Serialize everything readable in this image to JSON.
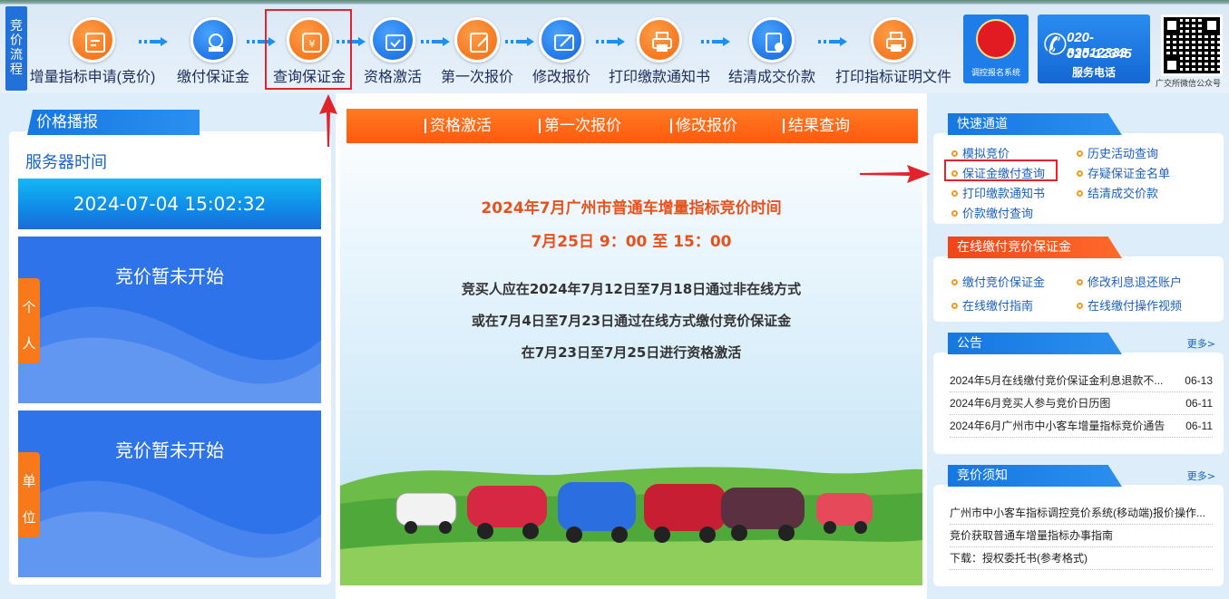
{
  "flow": {
    "label": "竞价流程",
    "steps": [
      {
        "label": "增量指标申请(竞价)",
        "icon": "application-form-icon",
        "color": "orange"
      },
      {
        "label": "缴付保证金",
        "icon": "deposit-payment-icon",
        "color": "blue"
      },
      {
        "label": "查询保证金",
        "icon": "deposit-query-icon",
        "color": "orange"
      },
      {
        "label": "资格激活",
        "icon": "activation-icon",
        "color": "blue"
      },
      {
        "label": "第一次报价",
        "icon": "first-bid-icon",
        "color": "orange"
      },
      {
        "label": "修改报价",
        "icon": "modify-bid-icon",
        "color": "blue"
      },
      {
        "label": "打印缴款通知书",
        "icon": "printer-icon",
        "color": "orange"
      },
      {
        "label": "结清成交价款",
        "icon": "settle-payment-icon",
        "color": "blue"
      },
      {
        "label": "打印指标证明文件",
        "icon": "printer-icon",
        "color": "orange"
      }
    ]
  },
  "header_right": {
    "system_caption": "调控报名系统",
    "phone1": "020-83512333",
    "phone2": "020-12345",
    "service_caption": "服务电话",
    "qr_caption": "广交所微信公众号"
  },
  "price_panel": {
    "title": "价格播报",
    "server_label": "服务器时间",
    "server_time": "2024-07-04 15:02:32",
    "personal": {
      "status": "竞价暂未开始",
      "tag_1": "个",
      "tag_2": "人"
    },
    "company": {
      "status": "竞价暂未开始",
      "tag_1": "单",
      "tag_2": "位"
    }
  },
  "banner": {
    "tabs": [
      "资格激活",
      "第一次报价",
      "修改报价",
      "结果查询"
    ],
    "headline": "2024年7月广州市普通车增量指标竞价时间",
    "headline_time": "7月25日 9：00 至 15：00",
    "notice_lines": [
      "竞买人应在2024年7月12日至7月18日通过非在线方式",
      "或在7月4日至7月23日通过在线方式缴付竞价保证金",
      "在7月23日至7月25日进行资格激活"
    ]
  },
  "sidebar": {
    "quick": {
      "title": "快速通道",
      "links": [
        "模拟竞价",
        "历史活动查询",
        "保证金缴付查询",
        "存疑保证金名单",
        "打印缴款通知书",
        "结清成交价款",
        "价款缴付查询"
      ]
    },
    "online_pay": {
      "title": "在线缴付竞价保证金",
      "links": [
        "缴付竞价保证金",
        "修改利息退还账户",
        "在线缴付指南",
        "在线缴付操作视频"
      ]
    },
    "announcements": {
      "title": "公告",
      "more": "更多>",
      "items": [
        {
          "text": "2024年5月在线缴付竞价保证金利息退款不...",
          "date": "06-13"
        },
        {
          "text": "2024年6月竞买人参与竞价日历图",
          "date": "06-11"
        },
        {
          "text": "2024年6月广州市中小客车增量指标竞价通告",
          "date": "06-11"
        }
      ]
    },
    "bid_notes": {
      "title": "竞价须知",
      "more": "更多>",
      "items": [
        {
          "text": "广州市中小客车指标调控竞价系统(移动端)报价操作..."
        },
        {
          "text": "竞价获取普通车增量指标办事指南"
        },
        {
          "text": "下载：授权委托书(参考格式)"
        }
      ]
    }
  },
  "colors": {
    "accent_orange": "#f06a12",
    "accent_blue": "#1677e0",
    "highlight_red": "#e3232b"
  }
}
